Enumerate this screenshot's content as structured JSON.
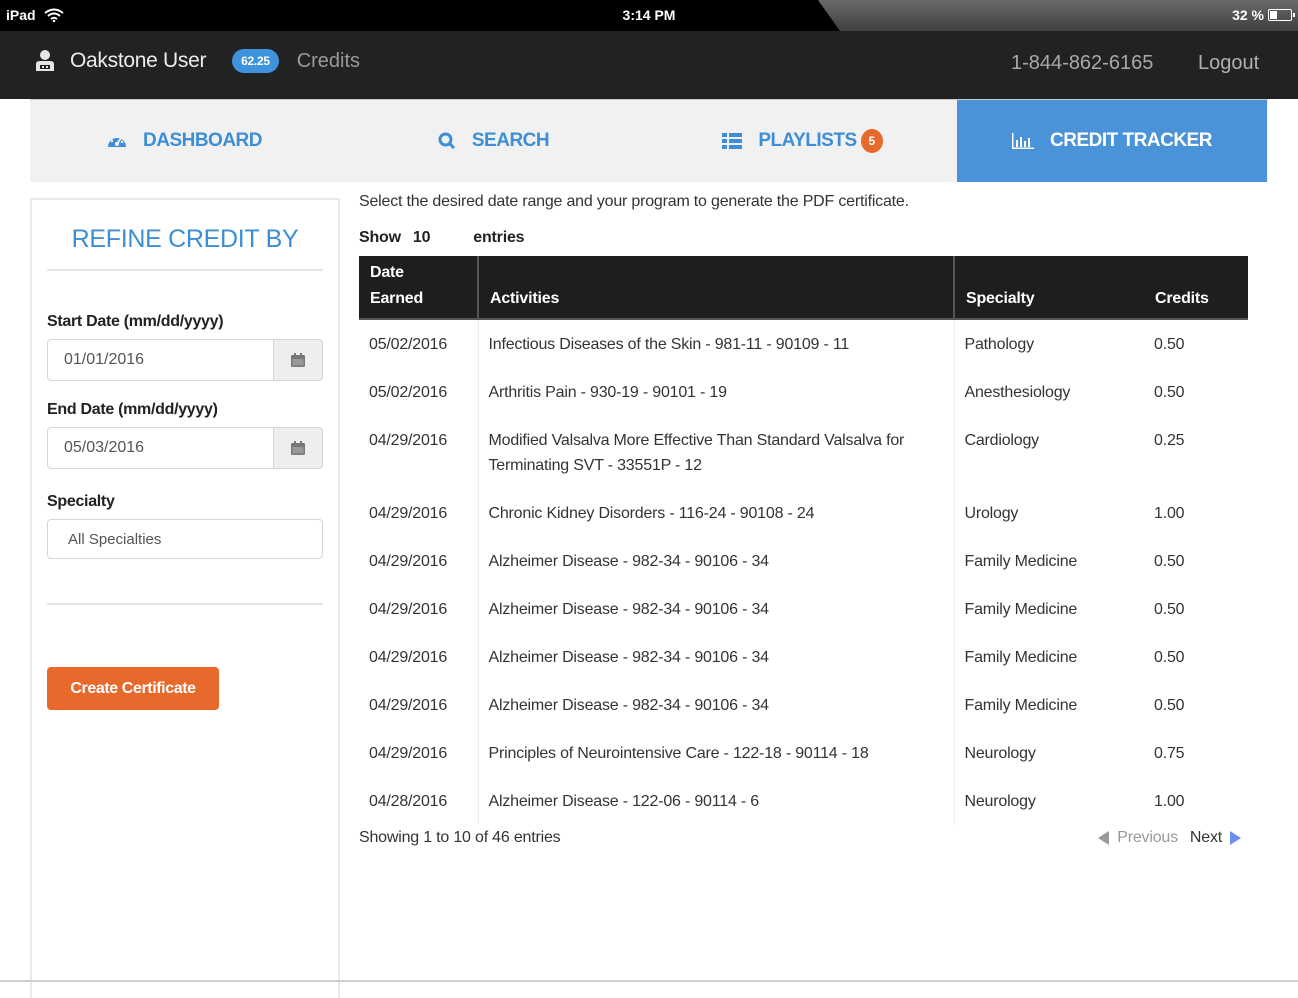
{
  "status_bar": {
    "device": "iPad",
    "time": "3:14 PM",
    "battery_percent": "32 %"
  },
  "header": {
    "user_name": "Oakstone User",
    "credits_value": "62.25",
    "credits_label": "Credits",
    "phone": "1-844-862-6165",
    "logout_label": "Logout"
  },
  "nav": {
    "tabs": [
      {
        "label": "DASHBOARD",
        "icon": "dashboard-icon"
      },
      {
        "label": "SEARCH",
        "icon": "search-icon"
      },
      {
        "label": "PLAYLISTS",
        "icon": "list-icon",
        "badge": "5"
      },
      {
        "label": "CREDIT TRACKER",
        "icon": "bar-chart-icon",
        "active": true
      }
    ]
  },
  "sidebar": {
    "title": "REFINE CREDIT BY",
    "start_date_label": "Start Date (mm/dd/yyyy)",
    "start_date_value": "01/01/2016",
    "end_date_label": "End Date (mm/dd/yyyy)",
    "end_date_value": "05/03/2016",
    "specialty_label": "Specialty",
    "specialty_value": "All Specialties",
    "create_button": "Create Certificate"
  },
  "main": {
    "intro": "Select the desired date range and your program to generate the PDF certificate.",
    "show_label": "Show",
    "show_value": "10",
    "entries_label": "entries",
    "table": {
      "headers": {
        "date_line1": "Date",
        "date_line2": "Earned",
        "activities": "Activities",
        "specialty": "Specialty",
        "credits": "Credits"
      },
      "rows": [
        {
          "date": "05/02/2016",
          "activity": "Infectious Diseases of the Skin - 981-11 - 90109 - 11",
          "specialty": "Pathology",
          "credits": "0.50"
        },
        {
          "date": "05/02/2016",
          "activity": "Arthritis Pain - 930-19 - 90101 - 19",
          "specialty": "Anesthesiology",
          "credits": "0.50"
        },
        {
          "date": "04/29/2016",
          "activity": "Modified Valsalva More Effective Than Standard Valsalva for Terminating SVT - 33551P - 12",
          "specialty": "Cardiology",
          "credits": "0.25"
        },
        {
          "date": "04/29/2016",
          "activity": "Chronic Kidney Disorders - 116-24 - 90108 - 24",
          "specialty": "Urology",
          "credits": "1.00"
        },
        {
          "date": "04/29/2016",
          "activity": "Alzheimer Disease - 982-34 - 90106 - 34",
          "specialty": "Family Medicine",
          "credits": "0.50"
        },
        {
          "date": "04/29/2016",
          "activity": "Alzheimer Disease - 982-34 - 90106 - 34",
          "specialty": "Family Medicine",
          "credits": "0.50"
        },
        {
          "date": "04/29/2016",
          "activity": "Alzheimer Disease - 982-34 - 90106 - 34",
          "specialty": "Family Medicine",
          "credits": "0.50"
        },
        {
          "date": "04/29/2016",
          "activity": "Alzheimer Disease - 982-34 - 90106 - 34",
          "specialty": "Family Medicine",
          "credits": "0.50"
        },
        {
          "date": "04/29/2016",
          "activity": "Principles of Neurointensive Care - 122-18 - 90114 - 18",
          "specialty": "Neurology",
          "credits": "0.75"
        },
        {
          "date": "04/28/2016",
          "activity": "Alzheimer Disease - 122-06 - 90114 - 6",
          "specialty": "Neurology",
          "credits": "1.00"
        }
      ]
    },
    "showing_text": "Showing 1 to 10 of 46 entries",
    "previous_label": "Previous",
    "next_label": "Next"
  }
}
